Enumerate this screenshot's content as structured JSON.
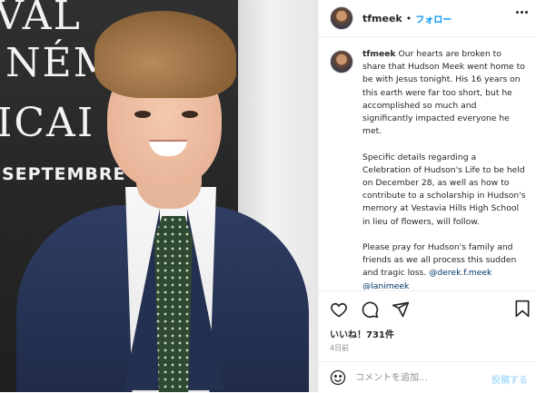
{
  "photo": {
    "backdrop_lines": [
      "VAL",
      "NÉM",
      "ICAI"
    ],
    "backdrop_date": "SEPTEMBRE 20"
  },
  "header": {
    "username": "tfmeek",
    "separator": "•",
    "follow_label": "フォロー"
  },
  "caption": {
    "username": "tfmeek",
    "text_before_mentions": "Our hearts are broken to share that Hudson Meek went home to be with Jesus tonight. His 16 years on this earth were far too short, but he accomplished so much and significantly impacted everyone he met.\n\nSpecific details regarding a Celebration of Hudson's Life to be held on December 28, as well as how to contribute to a scholarship in Hudson's memory at Vestavia Hills High School in lieu of flowers, will follow.\n\nPlease pray for Hudson's family and friends as we all process this sudden and tragic loss. ",
    "mention_1": "@derek.f.meek",
    "mention_2": "@lanimeek"
  },
  "actions": {
    "icons": [
      "heart-icon",
      "comment-icon",
      "share-icon",
      "bookmark-icon"
    ],
    "likes": "いいね！731件",
    "time_ago": "4日前"
  },
  "comment": {
    "placeholder": "コメントを追加...",
    "post_label": "投稿する"
  },
  "colors": {
    "link_blue": "#0095f6",
    "mention": "#00376b",
    "post_disabled": "#b2dffc"
  }
}
